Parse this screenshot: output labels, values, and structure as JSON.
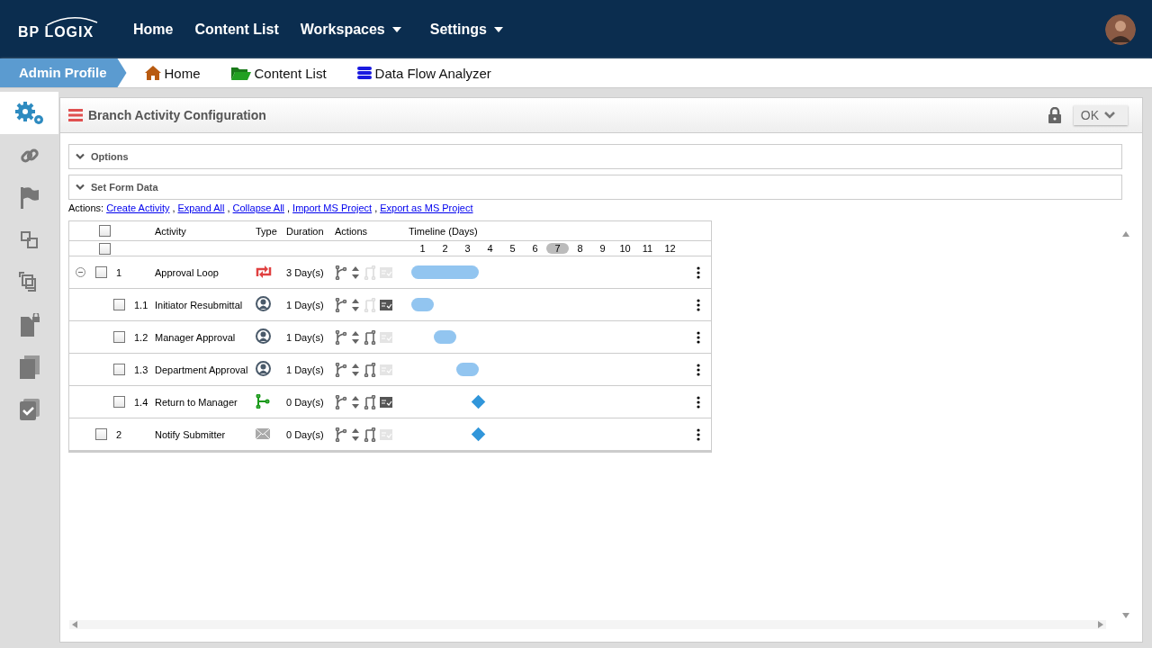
{
  "topbar": {
    "logo": "BP LOGIX",
    "nav": [
      {
        "label": "Home",
        "dropdown": false
      },
      {
        "label": "Content List",
        "dropdown": false
      },
      {
        "label": "Workspaces",
        "dropdown": true
      },
      {
        "label": "Settings",
        "dropdown": true
      }
    ]
  },
  "breadcrumb": {
    "profile": "Admin Profile",
    "links": [
      {
        "label": "Home",
        "kind": "home"
      },
      {
        "label": "Content List",
        "kind": "folder"
      },
      {
        "label": "Data Flow Analyzer",
        "kind": "database"
      }
    ]
  },
  "sidebar": {
    "items": [
      {
        "kind": "settings",
        "selected": true
      },
      {
        "kind": "link",
        "selected": false
      },
      {
        "kind": "flag",
        "selected": false
      },
      {
        "kind": "copy-small",
        "selected": false
      },
      {
        "kind": "copy",
        "selected": false
      },
      {
        "kind": "file-lock",
        "selected": false
      },
      {
        "kind": "pages",
        "selected": false
      },
      {
        "kind": "pages-check",
        "selected": false
      }
    ]
  },
  "panel": {
    "title": "Branch Activity Configuration",
    "locked": true,
    "ok_button": "OK"
  },
  "sections": [
    {
      "title": "Options",
      "expanded": false
    },
    {
      "title": "Set Form Data",
      "expanded": false
    }
  ],
  "actions": {
    "label": "Actions:",
    "separator": ",",
    "links": [
      "Create Activity",
      "Expand All",
      "Collapse All",
      "Import MS Project",
      "Export as MS Project"
    ]
  },
  "table": {
    "columns": [
      "Activity",
      "Type",
      "Duration",
      "Actions",
      "Timeline (Days)"
    ],
    "select_all_checked": false,
    "select_all_days_checked": false,
    "days": [
      {
        "label": "1",
        "highlighted": false
      },
      {
        "label": "2",
        "highlighted": false
      },
      {
        "label": "3",
        "highlighted": false
      },
      {
        "label": "4",
        "highlighted": false
      },
      {
        "label": "5",
        "highlighted": false
      },
      {
        "label": "6",
        "highlighted": false
      },
      {
        "label": "7",
        "highlighted": true
      },
      {
        "label": "8",
        "highlighted": false
      },
      {
        "label": "9",
        "highlighted": false
      },
      {
        "label": "10",
        "highlighted": false
      },
      {
        "label": "11",
        "highlighted": false
      },
      {
        "label": "12",
        "highlighted": false
      }
    ],
    "rows": [
      {
        "number": "1",
        "activity": "Approval Loop",
        "kind": "loop",
        "duration": "3 Day(s)",
        "checked": false,
        "expanded": true,
        "link_enabled": false,
        "form_enabled": false,
        "timeline": {
          "kind": "bar",
          "filled": [
            true,
            true,
            true,
            false,
            false,
            false,
            false,
            false,
            false,
            false,
            false,
            false
          ]
        },
        "children": [
          {
            "number": "1.1",
            "activity": "Initiator Resubmittal",
            "kind": "user",
            "duration": "1 Day(s)",
            "checked": false,
            "link_enabled": false,
            "form_enabled": true,
            "timeline": {
              "kind": "bar",
              "filled": [
                true,
                false,
                false,
                false,
                false,
                false,
                false,
                false,
                false,
                false,
                false,
                false
              ]
            }
          },
          {
            "number": "1.2",
            "activity": "Manager Approval",
            "kind": "user",
            "duration": "1 Day(s)",
            "checked": false,
            "link_enabled": true,
            "form_enabled": false,
            "timeline": {
              "kind": "bar",
              "filled": [
                false,
                true,
                false,
                false,
                false,
                false,
                false,
                false,
                false,
                false,
                false,
                false
              ]
            }
          },
          {
            "number": "1.3",
            "activity": "Department Approval",
            "kind": "user",
            "duration": "1 Day(s)",
            "checked": false,
            "link_enabled": true,
            "form_enabled": false,
            "timeline": {
              "kind": "bar",
              "filled": [
                false,
                false,
                true,
                false,
                false,
                false,
                false,
                false,
                false,
                false,
                false,
                false
              ]
            }
          },
          {
            "number": "1.4",
            "activity": "Return to Manager",
            "kind": "branch",
            "duration": "0 Day(s)",
            "checked": false,
            "link_enabled": true,
            "form_enabled": true,
            "timeline": {
              "kind": "milestone",
              "filled": [
                false,
                false,
                true,
                false,
                false,
                false,
                false,
                false,
                false,
                false,
                false,
                false
              ]
            }
          }
        ]
      },
      {
        "number": "2",
        "activity": "Notify Submitter",
        "kind": "email",
        "duration": "0 Day(s)",
        "checked": false,
        "link_enabled": true,
        "form_enabled": false,
        "timeline": {
          "kind": "milestone",
          "filled": [
            false,
            false,
            true,
            false,
            false,
            false,
            false,
            false,
            false,
            false,
            false,
            false
          ]
        }
      }
    ]
  }
}
